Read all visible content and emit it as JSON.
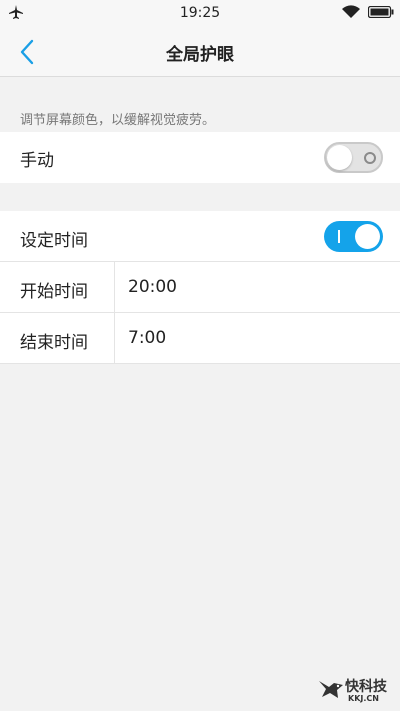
{
  "status_bar": {
    "time": "19:25",
    "airplane_icon": "airplane-icon",
    "wifi_icon": "wifi-icon",
    "battery_icon": "battery-icon"
  },
  "header": {
    "title": "全局护眼",
    "back_icon": "chevron-left-icon",
    "accent_color": "#1a9fe6"
  },
  "hint": "调节屏幕颜色，以缓解视觉疲劳。",
  "manual": {
    "label": "手动",
    "toggle_on": false
  },
  "schedule": {
    "label": "设定时间",
    "toggle_on": true,
    "toggle_color": "#14a3ea",
    "start_label": "开始时间",
    "start_time": "20:00",
    "end_label": "结束时间",
    "end_time": "7:00"
  },
  "watermark": {
    "main": "快科技",
    "sub": "KKJ.CN"
  }
}
